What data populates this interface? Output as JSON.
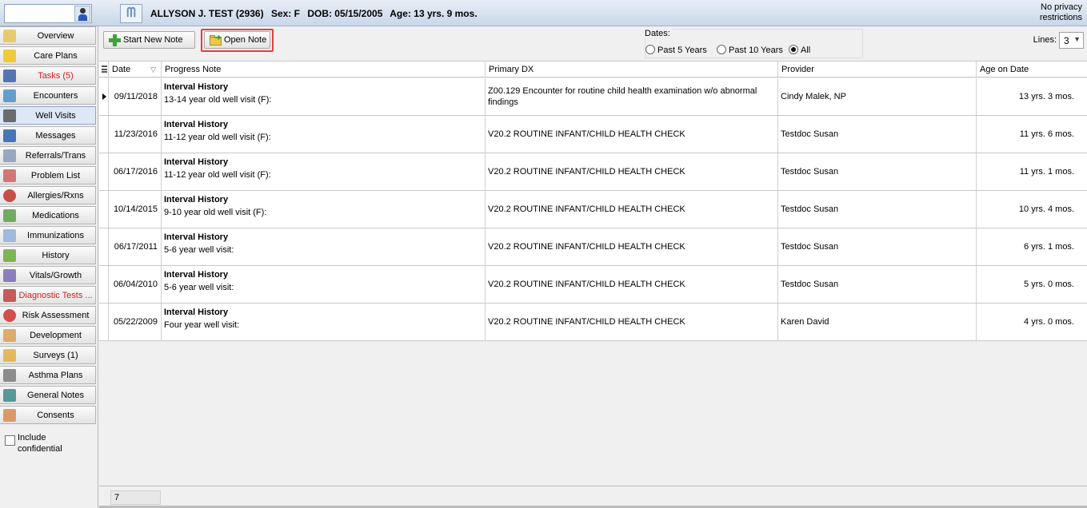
{
  "header": {
    "patient_name": "ALLYSON J. TEST (2936)",
    "sex": "Sex: F",
    "dob": "DOB: 05/15/2005",
    "age": "Age: 13 yrs. 9 mos.",
    "privacy_line1": "No privacy",
    "privacy_line2": "restrictions"
  },
  "sidebar": {
    "items": [
      {
        "label": "Overview",
        "icon": "folder-icon"
      },
      {
        "label": "Care Plans",
        "icon": "warning-icon"
      },
      {
        "label": "Tasks (5)",
        "icon": "checklist-icon"
      },
      {
        "label": "Encounters",
        "icon": "medical-kit-icon"
      },
      {
        "label": "Well Visits",
        "icon": "stethoscope-icon"
      },
      {
        "label": "Messages",
        "icon": "phone-icon"
      },
      {
        "label": "Referrals/Trans",
        "icon": "referral-icon"
      },
      {
        "label": "Problem List",
        "icon": "list-icon"
      },
      {
        "label": "Allergies/Rxns",
        "icon": "allergy-icon"
      },
      {
        "label": "Medications",
        "icon": "medication-icon"
      },
      {
        "label": "Immunizations",
        "icon": "syringe-icon"
      },
      {
        "label": "History",
        "icon": "family-tree-icon"
      },
      {
        "label": "Vitals/Growth",
        "icon": "pencil-icon"
      },
      {
        "label": "Diagnostic Tests ...",
        "icon": "test-tubes-icon"
      },
      {
        "label": "Risk Assessment",
        "icon": "no-sign-icon"
      },
      {
        "label": "Development",
        "icon": "development-icon"
      },
      {
        "label": "Surveys (1)",
        "icon": "survey-icon"
      },
      {
        "label": "Asthma Plans",
        "icon": "lungs-icon"
      },
      {
        "label": "General Notes",
        "icon": "notes-icon"
      },
      {
        "label": "Consents",
        "icon": "thumbs-up-icon"
      }
    ],
    "include_confidential": "Include confidential"
  },
  "toolbar": {
    "start_new_note": "Start New Note",
    "open_note": "Open Note",
    "dates_label": "Dates:",
    "past_5": "Past 5 Years",
    "past_10": "Past 10 Years",
    "all": "All",
    "lines_label": "Lines:",
    "lines_value": "3"
  },
  "table": {
    "headers": {
      "date": "Date",
      "note": "Progress Note",
      "dx": "Primary DX",
      "provider": "Provider",
      "age": "Age on Date"
    },
    "rows": [
      {
        "date": "09/11/2018",
        "title": "Interval History",
        "note": "13-14 year old well visit (F):",
        "dx": "Z00.129 Encounter for routine child health examination w/o abnormal findings",
        "provider": "Cindy Malek, NP",
        "age": "13 yrs. 3 mos."
      },
      {
        "date": "11/23/2016",
        "title": "Interval History",
        "note": "11-12 year old well visit (F):",
        "dx": "V20.2 ROUTINE INFANT/CHILD HEALTH CHECK",
        "provider": "Testdoc Susan",
        "age": "11 yrs. 6 mos."
      },
      {
        "date": "06/17/2016",
        "title": "Interval History",
        "note": "11-12 year old well visit (F):",
        "dx": "V20.2 ROUTINE INFANT/CHILD HEALTH CHECK",
        "provider": "Testdoc Susan",
        "age": "11 yrs. 1 mos."
      },
      {
        "date": "10/14/2015",
        "title": "Interval History",
        "note": "9-10 year old well visit (F):",
        "dx": "V20.2 ROUTINE INFANT/CHILD HEALTH CHECK",
        "provider": "Testdoc Susan",
        "age": "10 yrs. 4 mos."
      },
      {
        "date": "06/17/2011",
        "title": "Interval History",
        "note": "5-6 year well visit:",
        "dx": "V20.2 ROUTINE INFANT/CHILD HEALTH CHECK",
        "provider": "Testdoc Susan",
        "age": "6 yrs. 1 mos."
      },
      {
        "date": "06/04/2010",
        "title": "Interval History",
        "note": "5-6 year well visit:",
        "dx": "V20.2 ROUTINE INFANT/CHILD HEALTH CHECK",
        "provider": "Testdoc Susan",
        "age": "5 yrs. 0 mos."
      },
      {
        "date": "05/22/2009",
        "title": "Interval History",
        "note": "Four year well visit:",
        "dx": "V20.2 ROUTINE INFANT/CHILD HEALTH CHECK",
        "provider": "Karen David",
        "age": "4 yrs. 0 mos."
      }
    ]
  },
  "footer": {
    "count": "7"
  }
}
